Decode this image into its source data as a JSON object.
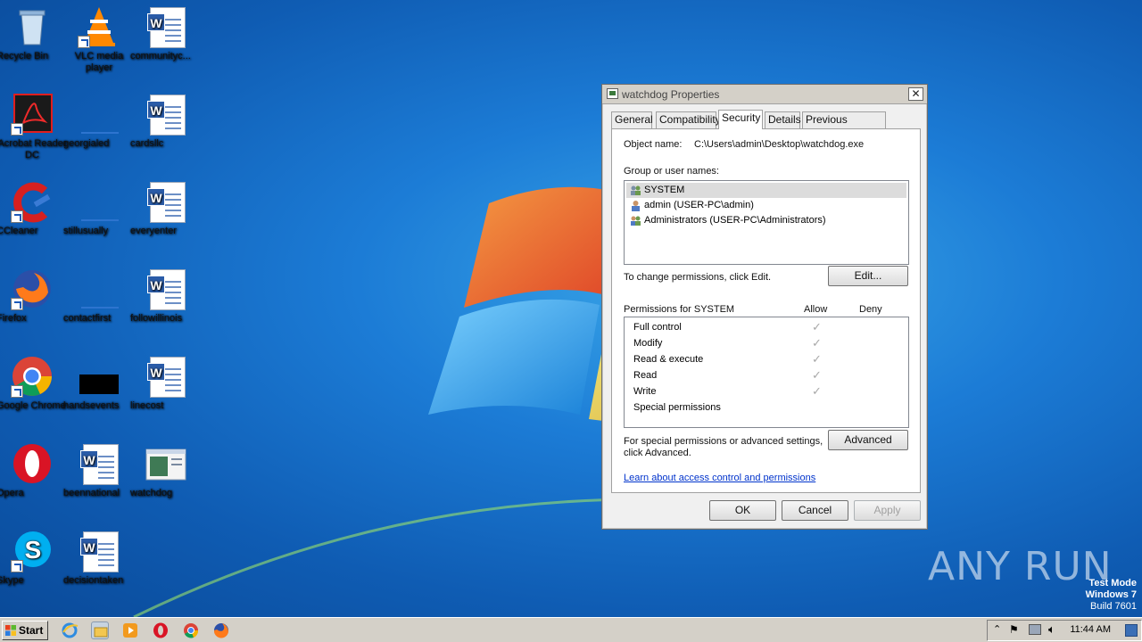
{
  "desktop": {
    "icons": [
      {
        "label": "Recycle Bin",
        "icon": "recycle-bin-icon"
      },
      {
        "label": "VLC media player",
        "icon": "vlc-icon"
      },
      {
        "label": "communityc...",
        "icon": "word-doc-icon"
      },
      {
        "label": "Acrobat Reader DC",
        "icon": "acrobat-icon"
      },
      {
        "label": "georgialed",
        "icon": "blank-file-icon"
      },
      {
        "label": "cardsllc",
        "icon": "word-doc-icon"
      },
      {
        "label": "CCleaner",
        "icon": "ccleaner-icon"
      },
      {
        "label": "stillusually",
        "icon": "blank-file-icon"
      },
      {
        "label": "everyenter",
        "icon": "word-doc-icon"
      },
      {
        "label": "Firefox",
        "icon": "firefox-icon"
      },
      {
        "label": "contactfirst",
        "icon": "blank-file-icon"
      },
      {
        "label": "followillinois",
        "icon": "word-doc-icon"
      },
      {
        "label": "Google Chrome",
        "icon": "chrome-icon"
      },
      {
        "label": "handsevents",
        "icon": "black-file-icon"
      },
      {
        "label": "linecost",
        "icon": "word-doc-icon"
      },
      {
        "label": "Opera",
        "icon": "opera-icon"
      },
      {
        "label": "beennational",
        "icon": "word-doc-icon"
      },
      {
        "label": "watchdog",
        "icon": "exe-icon"
      },
      {
        "label": "Skype",
        "icon": "skype-icon"
      },
      {
        "label": "decisiontaken",
        "icon": "word-doc-icon"
      }
    ]
  },
  "dialog": {
    "title": "watchdog Properties",
    "close": "✕",
    "tabs": [
      "General",
      "Compatibility",
      "Security",
      "Details",
      "Previous Versions"
    ],
    "active_tab": "Security",
    "object_name_label": "Object name:",
    "object_name_value": "C:\\Users\\admin\\Desktop\\watchdog.exe",
    "group_label": "Group or user names:",
    "users": [
      {
        "name": "SYSTEM",
        "selected": true
      },
      {
        "name": "admin (USER-PC\\admin)",
        "selected": false
      },
      {
        "name": "Administrators (USER-PC\\Administrators)",
        "selected": false
      }
    ],
    "change_text": "To change permissions, click Edit.",
    "edit_button": "Edit...",
    "permissions_label": "Permissions for SYSTEM",
    "allow_header": "Allow",
    "deny_header": "Deny",
    "permissions": [
      {
        "name": "Full control",
        "allow": true
      },
      {
        "name": "Modify",
        "allow": true
      },
      {
        "name": "Read & execute",
        "allow": true
      },
      {
        "name": "Read",
        "allow": true
      },
      {
        "name": "Write",
        "allow": true
      },
      {
        "name": "Special permissions",
        "allow": false
      }
    ],
    "advanced_text_1": "For special permissions or advanced settings,",
    "advanced_text_2": "click Advanced.",
    "advanced_button": "Advanced",
    "learn_link": "Learn about access control and permissions",
    "ok_button": "OK",
    "cancel_button": "Cancel",
    "apply_button": "Apply"
  },
  "taskbar": {
    "start_label": "Start",
    "pinned": [
      "ie-icon",
      "explorer-icon",
      "media-player-icon",
      "opera-icon",
      "chrome-icon",
      "firefox-icon"
    ],
    "clock": "11:44 AM"
  },
  "watermark": {
    "line1": "Test Mode",
    "line2": "Windows 7",
    "line3": "Build 7601",
    "brand": "ANY RUN"
  }
}
